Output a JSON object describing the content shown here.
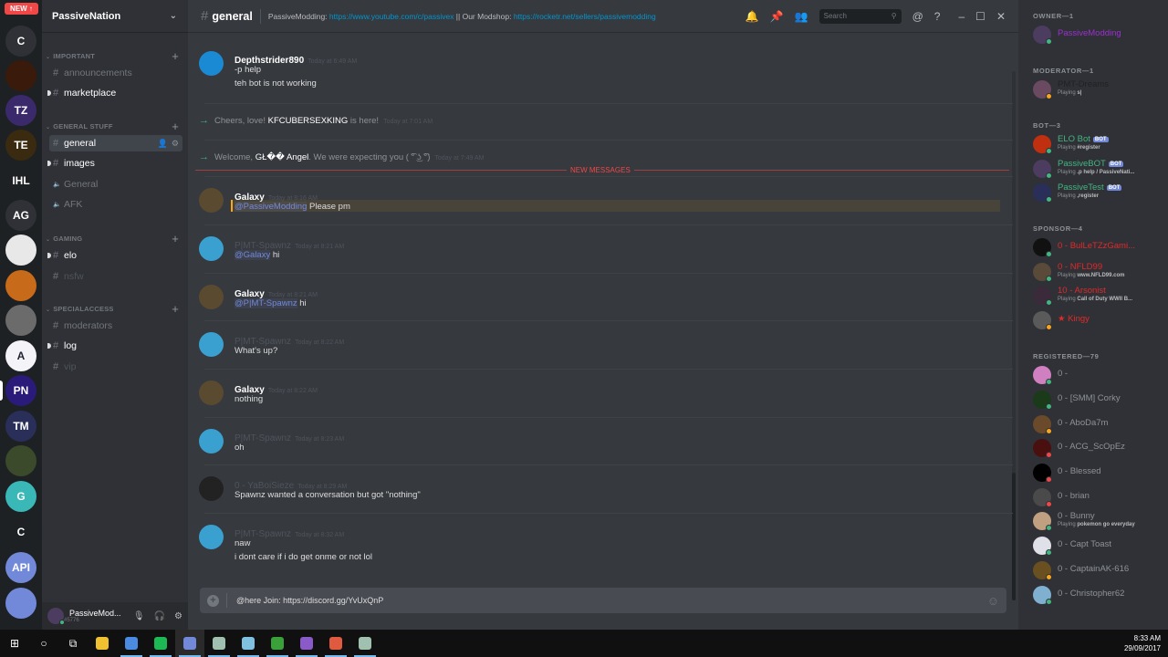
{
  "guilds": {
    "new_badge": "NEW ↑",
    "items": [
      {
        "label": "C",
        "color": "#2f3136"
      },
      {
        "label": "",
        "color": "#3a1a0a"
      },
      {
        "label": "TZ",
        "color": "#3b2a6b"
      },
      {
        "label": "TE",
        "color": "#3a2a10"
      },
      {
        "label": "IHL",
        "color": "#1e2124"
      },
      {
        "label": "AG",
        "color": "#2f3136"
      },
      {
        "label": "",
        "color": "#e8e8e8"
      },
      {
        "label": "",
        "color": "#c76a1a"
      },
      {
        "label": "",
        "color": "#6b6b6b"
      },
      {
        "label": "A",
        "color": "#f4f4f8"
      },
      {
        "label": "PN",
        "color": "#2a1a7a"
      },
      {
        "label": "TM",
        "color": "#2a2f5a"
      },
      {
        "label": "",
        "color": "#3a4a2a"
      },
      {
        "label": "G",
        "color": "#3ab8b8"
      },
      {
        "label": "C",
        "color": "#1e2124"
      },
      {
        "label": "API",
        "color": "#7289da"
      },
      {
        "label": "",
        "color": "#7289da"
      }
    ]
  },
  "server": {
    "name": "PassiveNation",
    "categories": [
      {
        "name": "IMPORTANT",
        "channels": [
          {
            "name": "announcements",
            "type": "text",
            "state": "read"
          },
          {
            "name": "marketplace",
            "type": "text",
            "state": "unread"
          }
        ]
      },
      {
        "name": "GENERAL STUFF",
        "channels": [
          {
            "name": "general",
            "type": "text",
            "state": "active"
          },
          {
            "name": "images",
            "type": "text",
            "state": "unread"
          },
          {
            "name": "General",
            "type": "voice",
            "state": "read"
          },
          {
            "name": "AFK",
            "type": "voice",
            "state": "read"
          }
        ]
      },
      {
        "name": "GAMING",
        "channels": [
          {
            "name": "elo",
            "type": "text",
            "state": "unread"
          },
          {
            "name": "nsfw",
            "type": "locked",
            "state": "muted"
          }
        ]
      },
      {
        "name": "SPECIALACCESS",
        "channels": [
          {
            "name": "moderators",
            "type": "locked",
            "state": "read"
          },
          {
            "name": "log",
            "type": "locked",
            "state": "unread"
          },
          {
            "name": "vip",
            "type": "locked",
            "state": "muted"
          }
        ]
      }
    ]
  },
  "user_panel": {
    "name": "PassiveMod...",
    "tag": "#5776"
  },
  "header": {
    "channel": "general",
    "topic_prefix": "PassiveModding: ",
    "topic_link1": "https://www.youtube.com/c/passivex",
    "topic_mid": " || Our Modshop: ",
    "topic_link2": "https://rocketr.net/sellers/passivemodding",
    "search_placeholder": "Search"
  },
  "messages": [
    {
      "author": "Depthstrider890",
      "time": "Today at 6:49 AM",
      "lines": [
        "-p help",
        "teh bot is not working"
      ],
      "faded": false,
      "avatar": "#1a8ad4"
    },
    {
      "system": true,
      "pre": "Cheers, love! ",
      "name": "KFCUBERSEXKING",
      "post": " is here!",
      "time": "Today at 7:01 AM"
    },
    {
      "system": true,
      "pre": "Welcome, ",
      "name": "GŁ�� Angel",
      "post": ". We were expecting you ( ͡° ͜ʖ ͡°)",
      "time": "Today at 7:49 AM"
    },
    {
      "author": "Galaxy",
      "time": "Today at 8:16 AM",
      "mention": "@PassiveModding",
      "text": " Please pm",
      "faded": false,
      "highlight": true,
      "avatar": "#5a4a30"
    },
    {
      "author": "P|MT-Spawnz",
      "time": "Today at 8:21 AM",
      "mention": "@Galaxy",
      "text": " hi",
      "faded": true,
      "avatar": "#3aa0d0"
    },
    {
      "author": "Galaxy",
      "time": "Today at 8:21 AM",
      "mention": "@P|MT-Spawnz",
      "text": " hi",
      "faded": false,
      "avatar": "#5a4a30"
    },
    {
      "author": "P|MT-Spawnz",
      "time": "Today at 8:22 AM",
      "lines": [
        "What's up?"
      ],
      "faded": true,
      "avatar": "#3aa0d0"
    },
    {
      "author": "Galaxy",
      "time": "Today at 8:22 AM",
      "lines": [
        "nothing"
      ],
      "faded": false,
      "avatar": "#5a4a30"
    },
    {
      "author": "P|MT-Spawnz",
      "time": "Today at 8:23 AM",
      "lines": [
        "oh"
      ],
      "faded": true,
      "avatar": "#3aa0d0"
    },
    {
      "author": "0 - YaBoiSieze",
      "time": "Today at 8:29 AM",
      "lines": [
        "Spawnz wanted a conversation but got \"nothing\""
      ],
      "faded": true,
      "avatar": "#222"
    },
    {
      "author": "P|MT-Spawnz",
      "time": "Today at 8:32 AM",
      "lines": [
        "naw",
        "i dont care if i do get onme or not lol"
      ],
      "faded": true,
      "avatar": "#3aa0d0"
    }
  ],
  "new_messages_label": "NEW MESSAGES",
  "composer": {
    "text": "@here Join: https://discord.gg/YvUxQnP"
  },
  "members": {
    "roles": [
      {
        "name": "OWNER—1",
        "members": [
          {
            "name": "PassiveModding",
            "color": "#9b30d0",
            "status": "mobile",
            "game": "",
            "bot": false,
            "avatar": "#4b3c60"
          }
        ]
      },
      {
        "name": "MODERATOR—1",
        "members": [
          {
            "name": "PMT-Dreams",
            "color": "#1f2124",
            "status": "idle",
            "game": "s|",
            "bot": false,
            "avatar": "#6a4a60"
          }
        ]
      },
      {
        "name": "BOT—3",
        "members": [
          {
            "name": "ELO Bot",
            "color": "#43b581",
            "status": "online",
            "game": "#register",
            "bot": true,
            "avatar": "#c03010"
          },
          {
            "name": "PassiveBOT",
            "color": "#43b581",
            "status": "online",
            "game": ".p help / PassiveNati...",
            "bot": true,
            "avatar": "#4b3c60"
          },
          {
            "name": "PassiveTest",
            "color": "#43b581",
            "status": "online",
            "game": ",register",
            "bot": true,
            "avatar": "#2a2f5a"
          }
        ]
      },
      {
        "name": "SPONSOR—4",
        "members": [
          {
            "name": "0 - BulLeTZzGami...",
            "color": "#e02a2a",
            "status": "online",
            "game": "",
            "bot": false,
            "avatar": "#111"
          },
          {
            "name": "0 - NFLD99",
            "color": "#e02a2a",
            "status": "online",
            "game": "www.NFLD99.com",
            "bot": false,
            "avatar": "#5a4a3a"
          },
          {
            "name": "10 - Arsonist",
            "color": "#e02a2a",
            "status": "online",
            "game": "Call of Duty WWII B...",
            "bot": false,
            "avatar": "#3a2a3a"
          },
          {
            "name": "★ Kingy",
            "color": "#e02a2a",
            "status": "idle",
            "game": "",
            "bot": false,
            "avatar": "#5a5a5a"
          }
        ]
      },
      {
        "name": "REGISTERED—79",
        "members": [
          {
            "name": "0 -",
            "color": "#8e9297",
            "status": "online",
            "game": "",
            "bot": false,
            "avatar": "#d080c0"
          },
          {
            "name": "0 - [SMM] Corky",
            "color": "#8e9297",
            "status": "online",
            "game": "",
            "bot": false,
            "avatar": "#1a3a1a"
          },
          {
            "name": "0 - AboDa7m",
            "color": "#8e9297",
            "status": "idle",
            "game": "",
            "bot": false,
            "avatar": "#6a4a2a"
          },
          {
            "name": "0 - ACG_ScOpEz",
            "color": "#8e9297",
            "status": "dnd",
            "game": "",
            "bot": false,
            "avatar": "#4a1010"
          },
          {
            "name": "0 - Blessed",
            "color": "#8e9297",
            "status": "dnd",
            "game": "",
            "bot": false,
            "avatar": "#000"
          },
          {
            "name": "0 - brian",
            "color": "#8e9297",
            "status": "dnd",
            "game": "",
            "bot": false,
            "avatar": "#4a4a4a"
          },
          {
            "name": "0 - Bunny",
            "color": "#8e9297",
            "status": "online",
            "game": "pokemon go everyday",
            "bot": false,
            "avatar": "#c0a080"
          },
          {
            "name": "0 - Capt Toast",
            "color": "#8e9297",
            "status": "online",
            "game": "",
            "bot": false,
            "avatar": "#e0e0e8"
          },
          {
            "name": "0 - CaptainAK-616",
            "color": "#8e9297",
            "status": "idle",
            "game": "",
            "bot": false,
            "avatar": "#6a5020"
          },
          {
            "name": "0 - Christopher62",
            "color": "#8e9297",
            "status": "online",
            "game": "",
            "bot": false,
            "avatar": "#80b0d0"
          }
        ]
      }
    ],
    "playing_prefix": "Playing "
  },
  "taskbar": {
    "time": "8:33 AM",
    "date": "29/09/2017",
    "apps": [
      {
        "name": "file-explorer",
        "color": "#f0c030",
        "active": false
      },
      {
        "name": "chrome",
        "color": "#4a8ae0",
        "active": true
      },
      {
        "name": "spotify",
        "color": "#1db954",
        "active": true
      },
      {
        "name": "discord",
        "color": "#7289da",
        "active": true
      },
      {
        "name": "app-window",
        "color": "#a0c0b0",
        "active": true
      },
      {
        "name": "notepad",
        "color": "#80c0e0",
        "active": true
      },
      {
        "name": "camtasia-green",
        "color": "#3aa03a",
        "active": true
      },
      {
        "name": "visual-studio",
        "color": "#8a5ac8",
        "active": true
      },
      {
        "name": "camtasia-red",
        "color": "#e05a40",
        "active": true
      },
      {
        "name": "app-window-2",
        "color": "#a0c0b0",
        "active": true
      }
    ]
  },
  "statuses": {
    "online": "#43b581",
    "idle": "#faa61a",
    "dnd": "#f04747",
    "mobile": "#43b581"
  }
}
